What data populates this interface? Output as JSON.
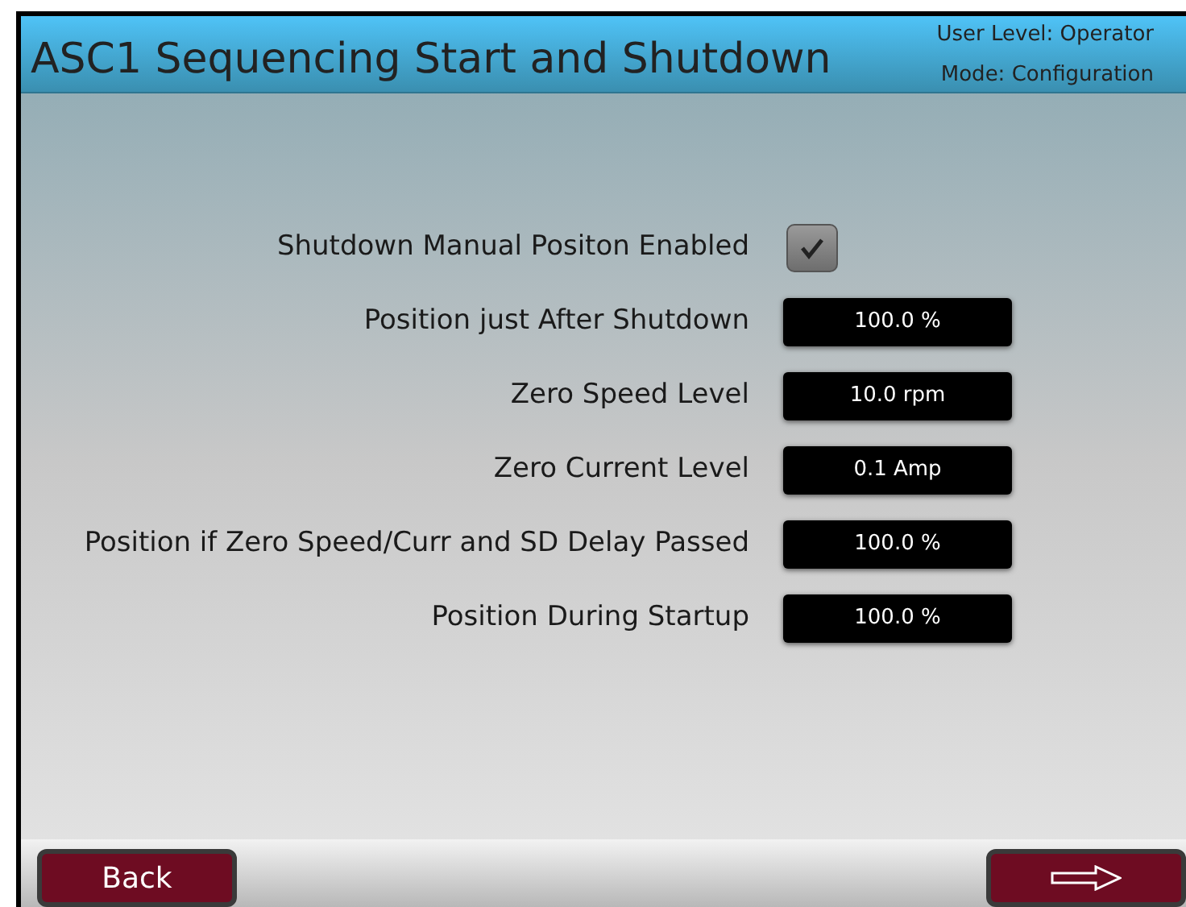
{
  "header": {
    "title": "ASC1 Sequencing Start and Shutdown",
    "user_level": "User Level: Operator",
    "mode": "Mode: Configuration"
  },
  "settings": [
    {
      "kind": "checkbox",
      "label": "Shutdown Manual Positon Enabled",
      "checked": true
    },
    {
      "kind": "value",
      "label": "Position just After Shutdown",
      "value": "100.0 %"
    },
    {
      "kind": "value",
      "label": "Zero Speed Level",
      "value": "10.0 rpm"
    },
    {
      "kind": "value",
      "label": "Zero Current Level",
      "value": "0.1 Amp"
    },
    {
      "kind": "value",
      "label": "Position if Zero Speed/Curr and SD Delay Passed",
      "value": "100.0 %"
    },
    {
      "kind": "value",
      "label": "Position During Startup",
      "value": "100.0 %"
    }
  ],
  "footer": {
    "back": "Back"
  }
}
